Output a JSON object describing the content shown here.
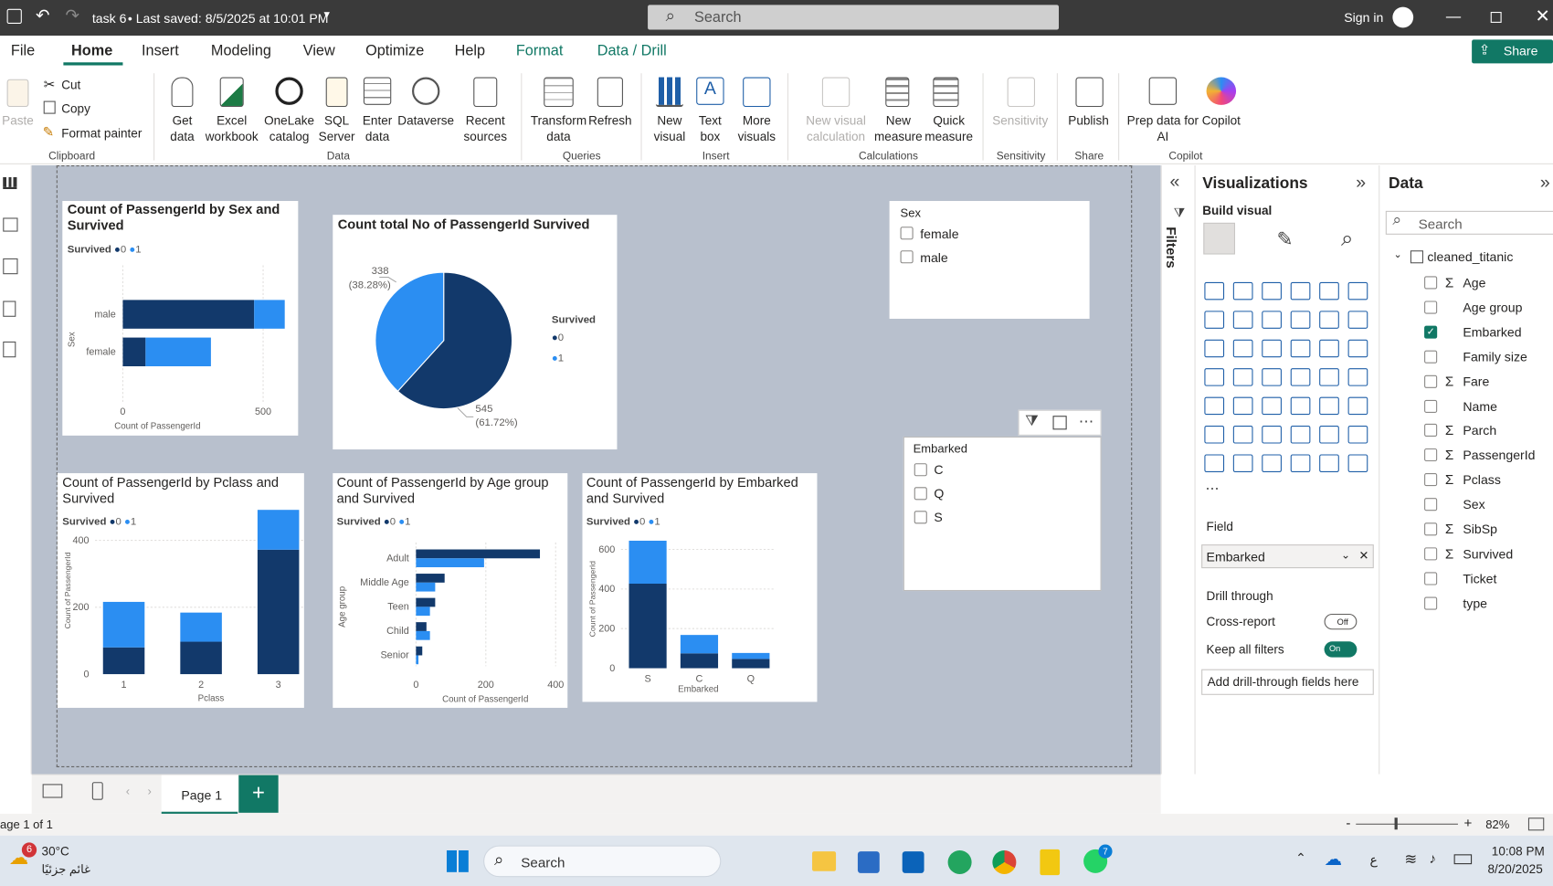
{
  "titlebar": {
    "doc_title": "task 6",
    "saved": "• Last saved: 8/5/2025 at 10:01 PM",
    "search_placeholder": "Search",
    "sign_in": "Sign in"
  },
  "menu": [
    "File",
    "Home",
    "Insert",
    "Modeling",
    "View",
    "Optimize",
    "Help",
    "Format",
    "Data / Drill"
  ],
  "share": "Share",
  "ribbon": {
    "clipboard": {
      "paste": "Paste",
      "cut": "Cut",
      "copy": "Copy",
      "format_painter": "Format painter",
      "group": "Clipboard"
    },
    "data": {
      "get_data": "Get data",
      "excel": "Excel workbook",
      "onelake": "OneLake catalog",
      "sql": "SQL Server",
      "enter": "Enter data",
      "dataverse": "Dataverse",
      "recent": "Recent sources",
      "group": "Data"
    },
    "queries": {
      "transform": "Transform data",
      "refresh": "Refresh",
      "group": "Queries"
    },
    "insert": {
      "new_visual": "New visual",
      "text_box": "Text box",
      "more_visuals": "More visuals",
      "group": "Insert"
    },
    "calculations": {
      "new_visual_calc": "New visual calculation",
      "new_measure": "New measure",
      "quick_measure": "Quick measure",
      "group": "Calculations"
    },
    "sensitivity": {
      "label": "Sensitivity",
      "group": "Sensitivity"
    },
    "share": {
      "publish": "Publish",
      "group": "Share"
    },
    "copilot": {
      "prep": "Prep data for AI",
      "copilot": "Copilot",
      "group": "Copilot"
    }
  },
  "visuals": {
    "sex_chart": {
      "title": "Count of PassengerId by Sex and Survived",
      "legend": "Survived",
      "xlabel": "Count of PassengerId",
      "ylabel": "Sex"
    },
    "pie": {
      "title": "Count total No of PassengerId Survived",
      "legend": "Survived",
      "label_light": "338",
      "label_light_pct": "(38.28%)",
      "label_dark": "545",
      "label_dark_pct": "(61.72%)"
    },
    "pclass_chart": {
      "title": "Count of PassengerId by Pclass and Survived",
      "legend": "Survived",
      "xlabel": "Pclass",
      "ylabel": "Count of PassengerId"
    },
    "age_chart": {
      "title": "Count of PassengerId by Age group and Survived",
      "legend": "Survived",
      "xlabel": "Count of PassengerId",
      "ylabel": "Age group"
    },
    "embarked_chart": {
      "title": "Count of PassengerId by Embarked and Survived",
      "legend": "Survived",
      "xlabel": "Embarked",
      "ylabel": "Count of Passengerld"
    },
    "sex_slicer": {
      "title": "Sex",
      "options": [
        "female",
        "male"
      ]
    },
    "embarked_slicer": {
      "title": "Embarked",
      "options": [
        "C",
        "Q",
        "S"
      ]
    }
  },
  "chart_data": [
    {
      "type": "bar",
      "orientation": "horizontal",
      "stacked": true,
      "title": "Count of PassengerId by Sex and Survived",
      "xlabel": "Count of PassengerId",
      "ylabel": "Sex",
      "categories": [
        "male",
        "female"
      ],
      "series": [
        {
          "name": "0",
          "values": [
            468,
            81
          ]
        },
        {
          "name": "1",
          "values": [
            109,
            233
          ]
        }
      ],
      "xticks": [
        "0",
        "500"
      ],
      "xlim": [
        0,
        600
      ]
    },
    {
      "type": "pie",
      "title": "Count total No of PassengerId Survived",
      "categories": [
        "0",
        "1"
      ],
      "values": [
        545,
        338
      ],
      "labels": [
        "545 (61.72%)",
        "338 (38.28%)"
      ]
    },
    {
      "type": "bar",
      "stacked": true,
      "title": "Count of PassengerId by Pclass and Survived",
      "xlabel": "Pclass",
      "ylabel": "Count of PassengerId",
      "categories": [
        "1",
        "2",
        "3"
      ],
      "series": [
        {
          "name": "0",
          "values": [
            80,
            97,
            372
          ]
        },
        {
          "name": "1",
          "values": [
            136,
            87,
            119
          ]
        }
      ],
      "yticks": [
        "0",
        "200",
        "400"
      ],
      "ylim": [
        0,
        500
      ]
    },
    {
      "type": "bar",
      "orientation": "horizontal",
      "title": "Count of PassengerId by Age group and Survived",
      "xlabel": "Count of PassengerId",
      "ylabel": "Age group",
      "categories": [
        "Adult",
        "Middle Age",
        "Teen",
        "Child",
        "Senior"
      ],
      "series": [
        {
          "name": "0",
          "values": [
            355,
            82,
            55,
            30,
            18
          ]
        },
        {
          "name": "1",
          "values": [
            195,
            55,
            40,
            40,
            7
          ]
        }
      ],
      "xticks": [
        "0",
        "200",
        "400"
      ],
      "xlim": [
        0,
        400
      ]
    },
    {
      "type": "bar",
      "stacked": true,
      "title": "Count of PassengerId by Embarked and Survived",
      "xlabel": "Embarked",
      "ylabel": "Count of Passengerld",
      "categories": [
        "S",
        "C",
        "Q"
      ],
      "series": [
        {
          "name": "0",
          "values": [
            427,
            75,
            47
          ]
        },
        {
          "name": "1",
          "values": [
            217,
            93,
            30
          ]
        }
      ],
      "yticks": [
        "0",
        "200",
        "400",
        "600"
      ],
      "ylim": [
        0,
        700
      ]
    }
  ],
  "filters_label": "Filters",
  "viz_panel": {
    "title": "Visualizations",
    "build": "Build visual",
    "field_label": "Field",
    "field_value": "Embarked",
    "drill": "Drill through",
    "cross": "Cross-report",
    "cross_state": "Off",
    "keep": "Keep all filters",
    "keep_state": "On",
    "add_fields": "Add drill-through fields here"
  },
  "data_panel": {
    "title": "Data",
    "search_placeholder": "Search",
    "table": "cleaned_titanic",
    "fields": [
      {
        "name": "Age",
        "sigma": true,
        "checked": false
      },
      {
        "name": "Age group",
        "sigma": false,
        "checked": false
      },
      {
        "name": "Embarked",
        "sigma": false,
        "checked": true
      },
      {
        "name": "Family size",
        "sigma": false,
        "checked": false
      },
      {
        "name": "Fare",
        "sigma": true,
        "checked": false
      },
      {
        "name": "Name",
        "sigma": false,
        "checked": false
      },
      {
        "name": "Parch",
        "sigma": true,
        "checked": false
      },
      {
        "name": "PassengerId",
        "sigma": true,
        "checked": false
      },
      {
        "name": "Pclass",
        "sigma": true,
        "checked": false
      },
      {
        "name": "Sex",
        "sigma": false,
        "checked": false
      },
      {
        "name": "SibSp",
        "sigma": true,
        "checked": false
      },
      {
        "name": "Survived",
        "sigma": true,
        "checked": false
      },
      {
        "name": "Ticket",
        "sigma": false,
        "checked": false
      },
      {
        "name": "type",
        "sigma": false,
        "checked": false
      }
    ]
  },
  "pages": {
    "tab": "Page 1",
    "status": "age 1 of 1",
    "zoom": "82%"
  },
  "taskbar": {
    "weather_temp": "30°C",
    "weather_desc": "غائم جزئيًا",
    "weather_badge": "6",
    "search": "Search",
    "time": "10:08 PM",
    "date": "8/20/2025",
    "lang": "ع",
    "whatsapp_badge": "7"
  },
  "colors": {
    "dark": "#12396b",
    "light": "#2b8ef2",
    "accent": "#117865"
  }
}
